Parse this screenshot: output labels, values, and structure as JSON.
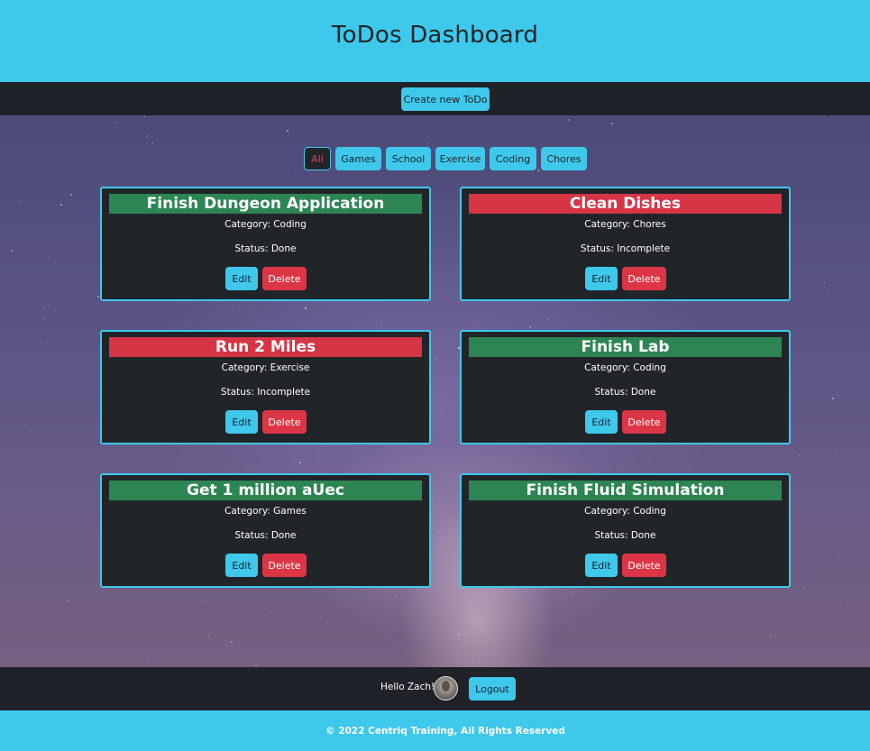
{
  "header": {
    "title": "ToDos Dashboard"
  },
  "toolbar": {
    "create_label": "Create new ToDo"
  },
  "filters": [
    "All",
    "Games",
    "School",
    "Exercise",
    "Coding",
    "Chores"
  ],
  "active_filter": "All",
  "todos": [
    {
      "title": "Finish Dungeon Application",
      "category": "Category: Coding",
      "status": "Status: Done",
      "state_color": "green"
    },
    {
      "title": "Clean Dishes",
      "category": "Category: Chores",
      "status": "Status: Incomplete",
      "state_color": "red"
    },
    {
      "title": "Run 2 Miles",
      "category": "Category: Exercise",
      "status": "Status: Incomplete",
      "state_color": "red"
    },
    {
      "title": "Finish Lab",
      "category": "Category: Coding",
      "status": "Status: Done",
      "state_color": "green"
    },
    {
      "title": "Get 1 million aUec",
      "category": "Category: Games",
      "status": "Status: Done",
      "state_color": "green"
    },
    {
      "title": "Finish Fluid Simulation",
      "category": "Category: Coding",
      "status": "Status: Done",
      "state_color": "green"
    }
  ],
  "card_actions": {
    "edit_label": "Edit",
    "delete_label": "Delete"
  },
  "userbar": {
    "greeting": "Hello Zach!",
    "logout_label": "Logout"
  },
  "footer": {
    "text": "© 2022 Centriq Training, All Rights Reserved"
  },
  "colors": {
    "accent": "#3ec8ec",
    "dark": "#212529",
    "done": "#2d8553",
    "incomplete": "#d63545",
    "danger": "#dc3545"
  }
}
